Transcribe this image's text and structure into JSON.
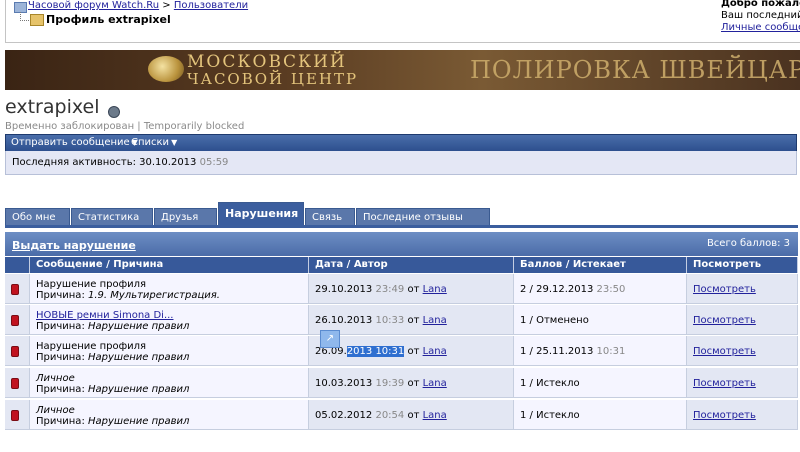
{
  "nav": {
    "forum_link": "Часовой форум Watch.Ru",
    "separator": " > ",
    "users_link": "Пользователи",
    "page_title": "Профиль extrapixel"
  },
  "welcome": {
    "greeting": "Добро пожалова",
    "last_visit": "Ваш последний ви",
    "private_messages": "Личные сообщени"
  },
  "banner": {
    "line1": "МОСКОВСКИЙ",
    "line2": "ЧАСОВОЙ ЦЕНТР",
    "right_text": "ПОЛИРОВКА ШВЕЙЦАРСКИ"
  },
  "profile": {
    "username": "extrapixel",
    "status": "Временно заблокирован | Temporarily blocked",
    "menu_send": "Отправить сообщение",
    "menu_lists": "Списки",
    "last_activity_label": "Последняя активность: 30.10.2013",
    "last_activity_time": "05:59"
  },
  "tabs": [
    {
      "label": "Обо мне"
    },
    {
      "label": "Статистика"
    },
    {
      "label": "Друзья"
    },
    {
      "label": "Нарушения"
    },
    {
      "label": "Связь"
    },
    {
      "label": "Последние отзывы"
    }
  ],
  "violations": {
    "issue_link": "Выдать нарушение",
    "total": "Всего баллов: 3",
    "columns": [
      "Сообщение / Причина",
      "Дата / Автор",
      "Баллов / Истекает",
      "Посмотреть"
    ],
    "rows": [
      {
        "title": "Нарушение профиля",
        "reason_label": "Причина:",
        "reason": "1.9. Мультирегистрация.",
        "date": "29.10.2013",
        "time": "23:49",
        "by": "от",
        "author": "Lana",
        "points": "2 / 29.12.2013",
        "expires_time": "23:50",
        "view": "Посмотреть"
      },
      {
        "title": "НОВЫЕ ремни Simona Di...",
        "reason_label": "Причина:",
        "reason": "Нарушение правил",
        "date": "26.10.2013",
        "time": "10:33",
        "by": "от",
        "author": "Lana",
        "points": "1 / Отменено",
        "expires_time": "",
        "view": "Посмотреть"
      },
      {
        "title": "Нарушение профиля",
        "reason_label": "Причина:",
        "reason": "Нарушение правил",
        "date": "26.09.",
        "time": "2013 10:31",
        "by": "от",
        "author": "Lana",
        "points": "1 / 25.11.2013",
        "expires_time": "10:31",
        "view": "Посмотреть"
      },
      {
        "title": "Личное",
        "reason_label": "Причина:",
        "reason": "Нарушение правил",
        "date": "10.03.2013",
        "time": "19:39",
        "by": "от",
        "author": "Lana",
        "points": "1 / Истекло",
        "expires_time": "",
        "view": "Посмотреть"
      },
      {
        "title": "Личное",
        "reason_label": "Причина:",
        "reason": "Нарушение правил",
        "date": "05.02.2012",
        "time": "20:54",
        "by": "от",
        "author": "Lana",
        "points": "1 / Истекло",
        "expires_time": "",
        "view": "Посмотреть"
      }
    ]
  }
}
